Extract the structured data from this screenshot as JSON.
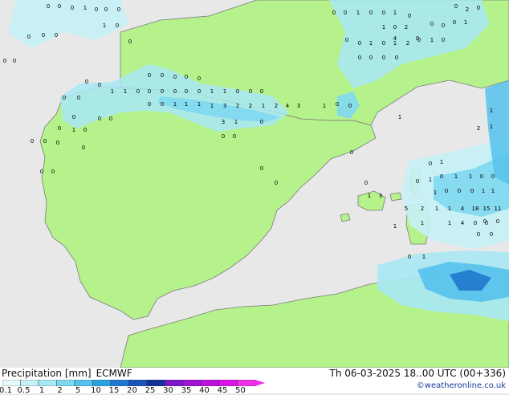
{
  "legend": {
    "title": "Precipitation [mm]",
    "model": "ECMWF",
    "datetime": "Th 06-03-2025 18..00 UTC (00+336)",
    "credit": "©weatheronline.co.uk",
    "scale": [
      {
        "label": "0.1",
        "color": "#e6fbfb"
      },
      {
        "label": "0.5",
        "color": "#c5f1f6"
      },
      {
        "label": "1",
        "color": "#a8e8f4"
      },
      {
        "label": "2",
        "color": "#7fd8f0"
      },
      {
        "label": "5",
        "color": "#55c2ec"
      },
      {
        "label": "10",
        "color": "#2aa1e0"
      },
      {
        "label": "15",
        "color": "#1f78cf"
      },
      {
        "label": "20",
        "color": "#1a54b8"
      },
      {
        "label": "25",
        "color": "#16309a"
      },
      {
        "label": "30",
        "color": "#7d16c8"
      },
      {
        "label": "35",
        "color": "#a012d6"
      },
      {
        "label": "40",
        "color": "#c010e0"
      },
      {
        "label": "45",
        "color": "#dd12e6"
      },
      {
        "label": "50",
        "color": "#f02ee8"
      }
    ]
  },
  "colors": {
    "sea": "#e8e8e8",
    "land": "#b6f28c",
    "coast": "#7a7a7a"
  },
  "map_values": [
    {
      "t": "0"
    },
    {
      "t": "0"
    },
    {
      "t": "0"
    },
    {
      "t": "1"
    },
    {
      "t": "0"
    },
    {
      "t": "0"
    },
    {
      "t": "0"
    },
    {
      "t": "1"
    },
    {
      "t": "0"
    },
    {
      "t": "0"
    },
    {
      "t": "0"
    },
    {
      "t": "0"
    },
    {
      "t": "0"
    },
    {
      "t": "0"
    },
    {
      "t": "0"
    },
    {
      "t": "0"
    },
    {
      "t": "0"
    },
    {
      "t": "1"
    },
    {
      "t": "0"
    },
    {
      "t": "0"
    },
    {
      "t": "1"
    },
    {
      "t": "0"
    },
    {
      "t": "0"
    },
    {
      "t": "2"
    },
    {
      "t": "0"
    },
    {
      "t": "1"
    },
    {
      "t": "0"
    },
    {
      "t": "2"
    },
    {
      "t": "0"
    },
    {
      "t": "0"
    },
    {
      "t": "0"
    },
    {
      "t": "1"
    },
    {
      "t": "4"
    },
    {
      "t": "0"
    },
    {
      "t": "0"
    },
    {
      "t": "0"
    },
    {
      "t": "1"
    },
    {
      "t": "0"
    },
    {
      "t": "1"
    },
    {
      "t": "2"
    },
    {
      "t": "0"
    },
    {
      "t": "1"
    },
    {
      "t": "0"
    },
    {
      "t": "0"
    },
    {
      "t": "0"
    },
    {
      "t": "0"
    },
    {
      "t": "0"
    },
    {
      "t": "0"
    },
    {
      "t": "0"
    },
    {
      "t": "0"
    },
    {
      "t": "0"
    },
    {
      "t": "0"
    },
    {
      "t": "0"
    },
    {
      "t": "0"
    },
    {
      "t": "1"
    },
    {
      "t": "1"
    },
    {
      "t": "0"
    },
    {
      "t": "0"
    },
    {
      "t": "0"
    },
    {
      "t": "0"
    },
    {
      "t": "0"
    },
    {
      "t": "0"
    },
    {
      "t": "1"
    },
    {
      "t": "1"
    },
    {
      "t": "0"
    },
    {
      "t": "0"
    },
    {
      "t": "0"
    },
    {
      "t": "0"
    },
    {
      "t": "0"
    },
    {
      "t": "0"
    },
    {
      "t": "0"
    },
    {
      "t": "1"
    },
    {
      "t": "1"
    },
    {
      "t": "1"
    },
    {
      "t": "1"
    },
    {
      "t": "3"
    },
    {
      "t": "2"
    },
    {
      "t": "2"
    },
    {
      "t": "1"
    },
    {
      "t": "2"
    },
    {
      "t": "4"
    },
    {
      "t": "3"
    },
    {
      "t": "1"
    },
    {
      "t": "0"
    },
    {
      "t": "0"
    },
    {
      "t": "3"
    },
    {
      "t": "1"
    },
    {
      "t": "0"
    },
    {
      "t": "0"
    },
    {
      "t": "0"
    },
    {
      "t": "0"
    },
    {
      "t": "0"
    },
    {
      "t": "1"
    },
    {
      "t": "0"
    },
    {
      "t": "0"
    },
    {
      "t": "0"
    },
    {
      "t": "0"
    },
    {
      "t": "0"
    },
    {
      "t": "0"
    },
    {
      "t": "0"
    },
    {
      "t": "0"
    },
    {
      "t": "0"
    },
    {
      "t": "0"
    },
    {
      "t": "1"
    },
    {
      "t": "0"
    },
    {
      "t": "1"
    },
    {
      "t": "0"
    },
    {
      "t": "0"
    },
    {
      "t": "0"
    },
    {
      "t": "0"
    },
    {
      "t": "1"
    },
    {
      "t": "0"
    },
    {
      "t": "1"
    },
    {
      "t": "1"
    },
    {
      "t": "0"
    },
    {
      "t": "0"
    },
    {
      "t": "1"
    },
    {
      "t": "2"
    },
    {
      "t": "1"
    },
    {
      "t": "1"
    },
    {
      "t": "0"
    },
    {
      "t": "0"
    },
    {
      "t": "0"
    },
    {
      "t": "1"
    },
    {
      "t": "1"
    },
    {
      "t": "1"
    },
    {
      "t": "3"
    },
    {
      "t": "5"
    },
    {
      "t": "2"
    },
    {
      "t": "1"
    },
    {
      "t": "1"
    },
    {
      "t": "4"
    },
    {
      "t": "18"
    },
    {
      "t": "15"
    },
    {
      "t": "11"
    },
    {
      "t": "0"
    },
    {
      "t": "0"
    },
    {
      "t": "1"
    },
    {
      "t": "1"
    },
    {
      "t": "1"
    },
    {
      "t": "4"
    },
    {
      "t": "0"
    },
    {
      "t": "0"
    },
    {
      "t": "0"
    },
    {
      "t": "0"
    },
    {
      "t": "0"
    },
    {
      "t": "1"
    }
  ]
}
